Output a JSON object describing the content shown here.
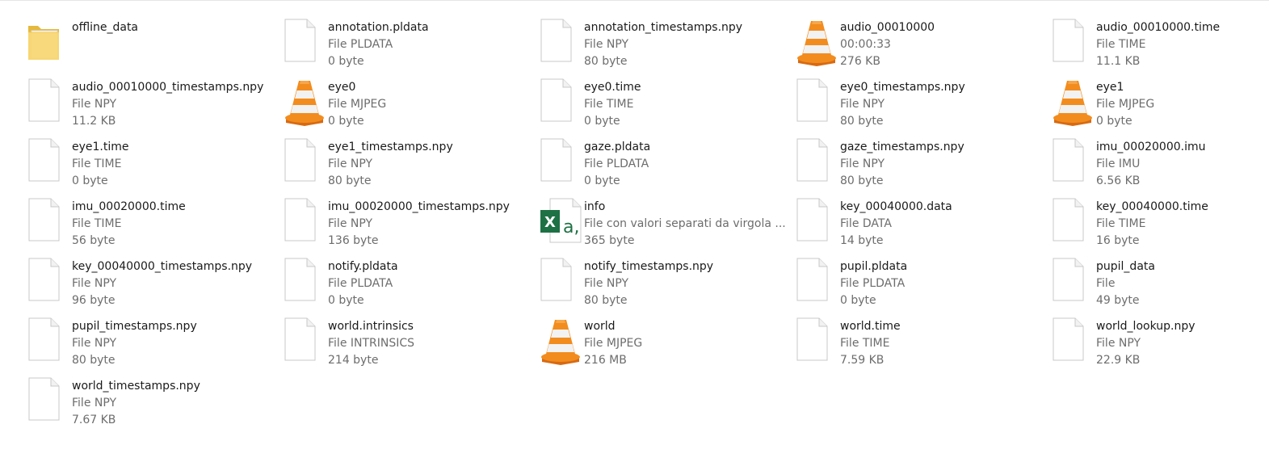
{
  "colors": {
    "name_text": "#1a1a1a",
    "meta_text": "#6d6d6d",
    "folder_yellow": "#f8d775",
    "vlc_orange": "#f28c1e",
    "excel_green": "#1e7145"
  },
  "files": [
    {
      "name": "offline_data",
      "type": "",
      "size": "",
      "icon": "folder-icon"
    },
    {
      "name": "annotation.pldata",
      "type": "File PLDATA",
      "size": "0 byte",
      "icon": "blank-file-icon"
    },
    {
      "name": "annotation_timestamps.npy",
      "type": "File NPY",
      "size": "80 byte",
      "icon": "blank-file-icon"
    },
    {
      "name": "audio_00010000",
      "type": "00:00:33",
      "size": "276 KB",
      "icon": "vlc-cone-icon"
    },
    {
      "name": "audio_00010000.time",
      "type": "File TIME",
      "size": "11.1 KB",
      "icon": "blank-file-icon"
    },
    {
      "name": "audio_00010000_timestamps.npy",
      "type": "File NPY",
      "size": "11.2 KB",
      "icon": "blank-file-icon"
    },
    {
      "name": "eye0",
      "type": "File MJPEG",
      "size": "0 byte",
      "icon": "vlc-cone-icon"
    },
    {
      "name": "eye0.time",
      "type": "File TIME",
      "size": "0 byte",
      "icon": "blank-file-icon"
    },
    {
      "name": "eye0_timestamps.npy",
      "type": "File NPY",
      "size": "80 byte",
      "icon": "blank-file-icon"
    },
    {
      "name": "eye1",
      "type": "File MJPEG",
      "size": "0 byte",
      "icon": "vlc-cone-icon"
    },
    {
      "name": "eye1.time",
      "type": "File TIME",
      "size": "0 byte",
      "icon": "blank-file-icon"
    },
    {
      "name": "eye1_timestamps.npy",
      "type": "File NPY",
      "size": "80 byte",
      "icon": "blank-file-icon"
    },
    {
      "name": "gaze.pldata",
      "type": "File PLDATA",
      "size": "0 byte",
      "icon": "blank-file-icon"
    },
    {
      "name": "gaze_timestamps.npy",
      "type": "File NPY",
      "size": "80 byte",
      "icon": "blank-file-icon"
    },
    {
      "name": "imu_00020000.imu",
      "type": "File IMU",
      "size": "6.56 KB",
      "icon": "blank-file-icon"
    },
    {
      "name": "imu_00020000.time",
      "type": "File TIME",
      "size": "56 byte",
      "icon": "blank-file-icon"
    },
    {
      "name": "imu_00020000_timestamps.npy",
      "type": "File NPY",
      "size": "136 byte",
      "icon": "blank-file-icon"
    },
    {
      "name": "info",
      "type": "File con valori separati da virgola ...",
      "size": "365 byte",
      "icon": "excel-csv-icon"
    },
    {
      "name": "key_00040000.data",
      "type": "File DATA",
      "size": "14 byte",
      "icon": "blank-file-icon"
    },
    {
      "name": "key_00040000.time",
      "type": "File TIME",
      "size": "16 byte",
      "icon": "blank-file-icon"
    },
    {
      "name": "key_00040000_timestamps.npy",
      "type": "File NPY",
      "size": "96 byte",
      "icon": "blank-file-icon"
    },
    {
      "name": "notify.pldata",
      "type": "File PLDATA",
      "size": "0 byte",
      "icon": "blank-file-icon"
    },
    {
      "name": "notify_timestamps.npy",
      "type": "File NPY",
      "size": "80 byte",
      "icon": "blank-file-icon"
    },
    {
      "name": "pupil.pldata",
      "type": "File PLDATA",
      "size": "0 byte",
      "icon": "blank-file-icon"
    },
    {
      "name": "pupil_data",
      "type": "File",
      "size": "49 byte",
      "icon": "blank-file-icon"
    },
    {
      "name": "pupil_timestamps.npy",
      "type": "File NPY",
      "size": "80 byte",
      "icon": "blank-file-icon"
    },
    {
      "name": "world.intrinsics",
      "type": "File INTRINSICS",
      "size": "214 byte",
      "icon": "blank-file-icon"
    },
    {
      "name": "world",
      "type": "File MJPEG",
      "size": "216 MB",
      "icon": "vlc-cone-icon"
    },
    {
      "name": "world.time",
      "type": "File TIME",
      "size": "7.59 KB",
      "icon": "blank-file-icon"
    },
    {
      "name": "world_lookup.npy",
      "type": "File NPY",
      "size": "22.9 KB",
      "icon": "blank-file-icon"
    },
    {
      "name": "world_timestamps.npy",
      "type": "File NPY",
      "size": "7.67 KB",
      "icon": "blank-file-icon"
    }
  ]
}
